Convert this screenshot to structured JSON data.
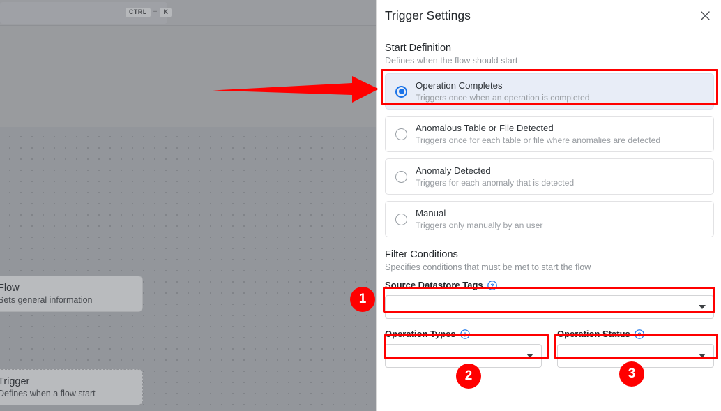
{
  "canvas": {
    "search": {
      "kbd_ctrl": "CTRL",
      "kbd_plus": "+",
      "kbd_key": "K"
    },
    "nodes": [
      {
        "icon": "hierarchy-icon",
        "title": "Flow",
        "subtitle": "Sets general information"
      },
      {
        "icon": "broadcast-icon",
        "title": "Trigger",
        "subtitle": "Defines when a flow start"
      }
    ]
  },
  "panel": {
    "title": "Trigger Settings",
    "close_icon": "close-icon",
    "start_definition": {
      "title": "Start Definition",
      "subtitle": "Defines when the flow should start",
      "options": [
        {
          "label": "Operation Completes",
          "description": "Triggers once when an operation is completed",
          "selected": true
        },
        {
          "label": "Anomalous Table or File Detected",
          "description": "Triggers once for each table or file where anomalies are detected",
          "selected": false
        },
        {
          "label": "Anomaly Detected",
          "description": "Triggers for each anomaly that is detected",
          "selected": false
        },
        {
          "label": "Manual",
          "description": "Triggers only manually by an user",
          "selected": false
        }
      ]
    },
    "filter_conditions": {
      "title": "Filter Conditions",
      "subtitle": "Specifies conditions that must be met to start the flow",
      "fields": [
        {
          "label": "Source Datastore Tags",
          "value": "",
          "help_icon": "help-circle-icon"
        },
        {
          "label": "Operation Types",
          "value": "",
          "help_icon": "help-circle-icon"
        },
        {
          "label": "Operation Status",
          "value": "",
          "help_icon": "help-circle-icon"
        }
      ]
    }
  },
  "annotations": {
    "highlight_color": "#ff0000",
    "arrow": {
      "name": "pointer-arrow",
      "direction": "right"
    },
    "markers": [
      {
        "number": "1"
      },
      {
        "number": "2"
      },
      {
        "number": "3"
      }
    ]
  }
}
